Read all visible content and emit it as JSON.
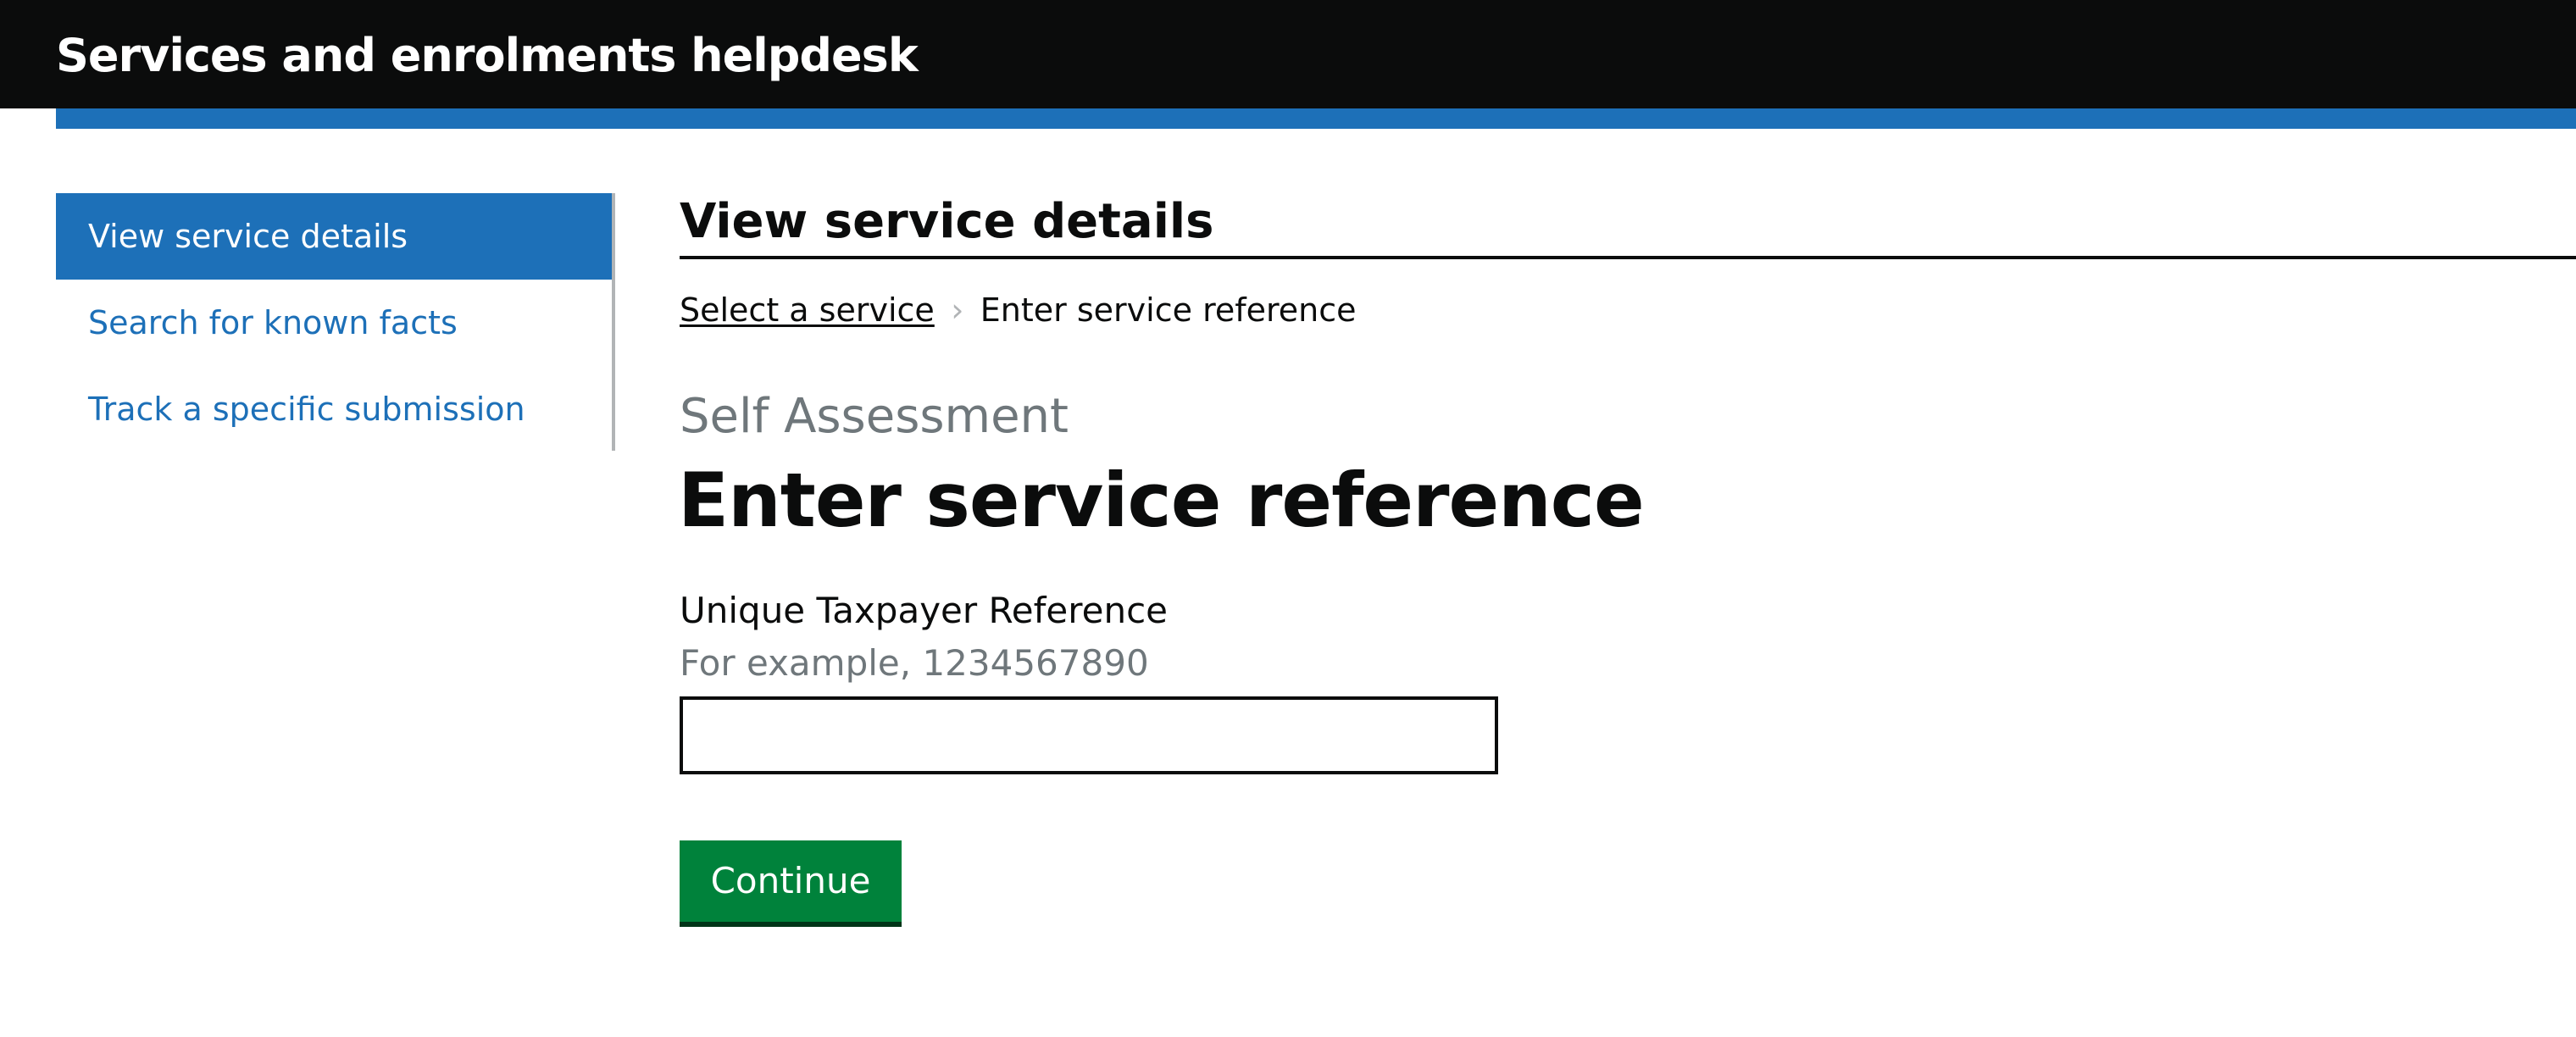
{
  "header": {
    "title": "Services and enrolments helpdesk"
  },
  "sidebar": {
    "items": [
      {
        "label": "View service details",
        "active": true
      },
      {
        "label": "Search for known facts",
        "active": false
      },
      {
        "label": "Track a specific submission",
        "active": false
      }
    ]
  },
  "main": {
    "heading": "View service details",
    "breadcrumb": {
      "link_label": "Select a service",
      "current_label": "Enter service reference"
    },
    "caption": "Self Assessment",
    "title": "Enter service reference",
    "field": {
      "label": "Unique Taxpayer Reference",
      "hint": "For example, 1234567890",
      "value": "",
      "placeholder": ""
    },
    "continue_label": "Continue"
  },
  "colors": {
    "header_bg": "#0b0c0c",
    "brand_blue": "#1d70b8",
    "button_green": "#00823b",
    "secondary_text": "#6f777b"
  }
}
